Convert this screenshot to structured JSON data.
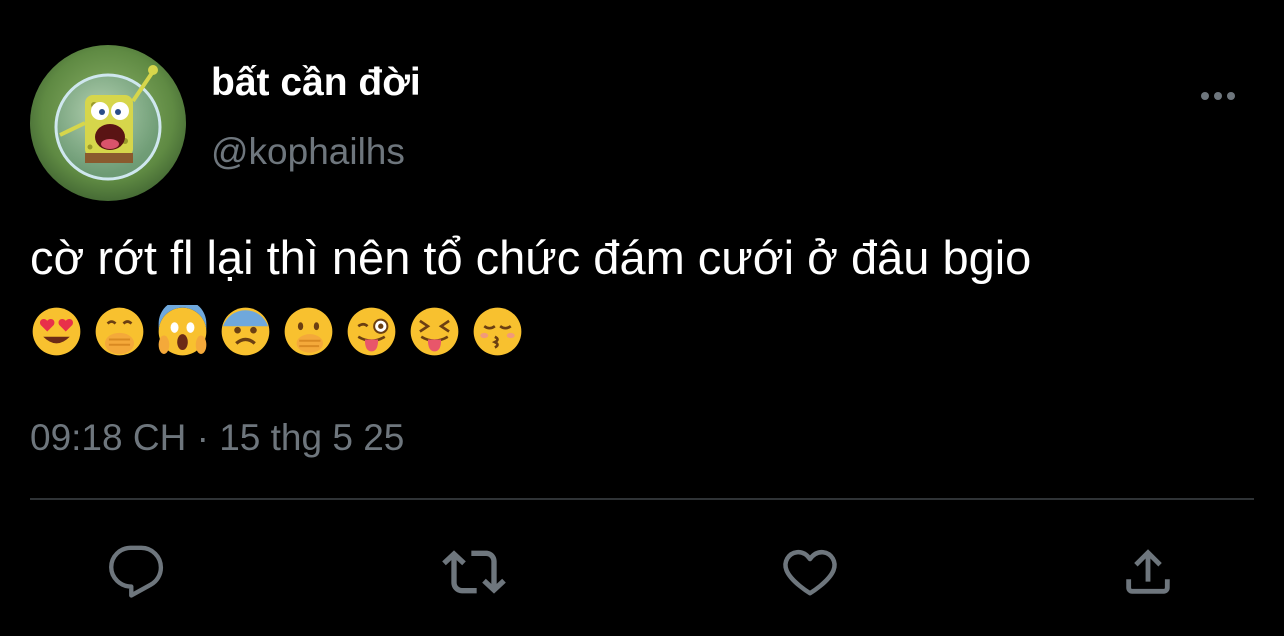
{
  "tweet": {
    "display_name": "bất cần đời",
    "handle": "@kophailhs",
    "text": "cờ rớt fl lại thì nên tổ chức đám cưới ở đâu bgio",
    "emojis": [
      "😍",
      "🤭",
      "😱",
      "😨",
      "🤭",
      "😜",
      "😝",
      "😚"
    ],
    "timestamp": "09:18 CH · 15 thg 5 25"
  },
  "icons": {
    "more": "more-horizontal-icon",
    "reply": "reply-icon",
    "retweet": "retweet-icon",
    "like": "heart-icon",
    "share": "share-icon"
  },
  "colors": {
    "background": "#000000",
    "text_primary": "#ffffff",
    "text_secondary": "#6e767d",
    "divider": "#2f3336",
    "icon": "#6e767d"
  }
}
